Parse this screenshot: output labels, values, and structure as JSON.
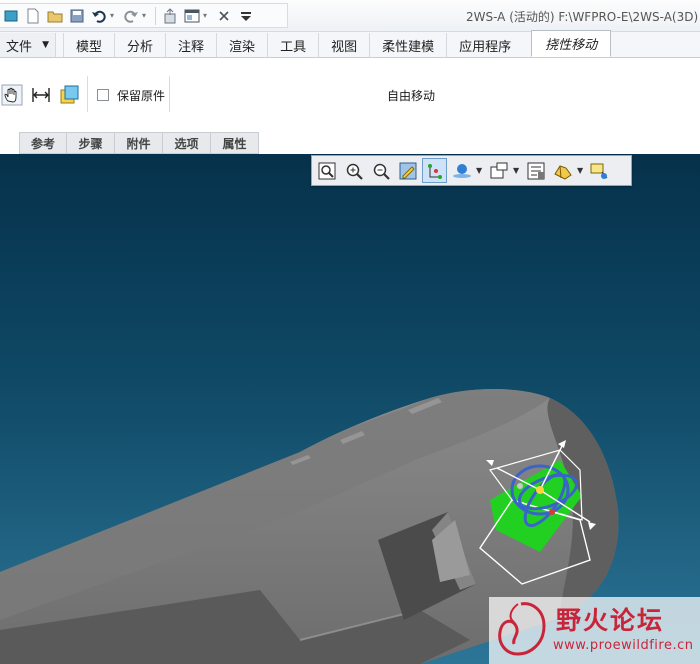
{
  "window": {
    "title": "2WS-A (活动的) F:\\WFPRO-E\\2WS-A(3D)"
  },
  "quick_access": {
    "icons": [
      "app-icon",
      "new-icon",
      "open-icon",
      "save-icon",
      "undo-icon",
      "redo-icon",
      "regenerate-icon",
      "windows-icon",
      "close-window-icon",
      "customize-icon"
    ]
  },
  "tabs": {
    "file": "文件",
    "items": [
      "模型",
      "分析",
      "注释",
      "渲染",
      "工具",
      "视图",
      "柔性建模",
      "应用程序"
    ],
    "active": "挠性移动"
  },
  "ribbon": {
    "keep_original_label": "保留原件",
    "keep_original_checked": false,
    "free_move_label": "自由移动",
    "tools": [
      "drag-hand-icon",
      "measure-icon",
      "copy-geometry-icon"
    ]
  },
  "subtabs": [
    "参考",
    "步骤",
    "附件",
    "选项",
    "属性"
  ],
  "graphics_toolbar": {
    "buttons": [
      "refit-icon",
      "zoom-in-icon",
      "zoom-out-icon",
      "repaint-icon",
      "datum-display-icon",
      "spin-center-icon",
      "saved-views-icon",
      "view-manager-icon",
      "display-style-icon",
      "annotation-display-icon"
    ]
  },
  "watermark": {
    "text": "野火论坛",
    "url": "www.proewildfire.cn"
  },
  "colors": {
    "viewport_top": "#06314b",
    "viewport_bottom": "#2d7597",
    "part_gray": "#6f6f6f",
    "dragger_green": "#1fd11f",
    "watermark_red": "#c9253a"
  }
}
